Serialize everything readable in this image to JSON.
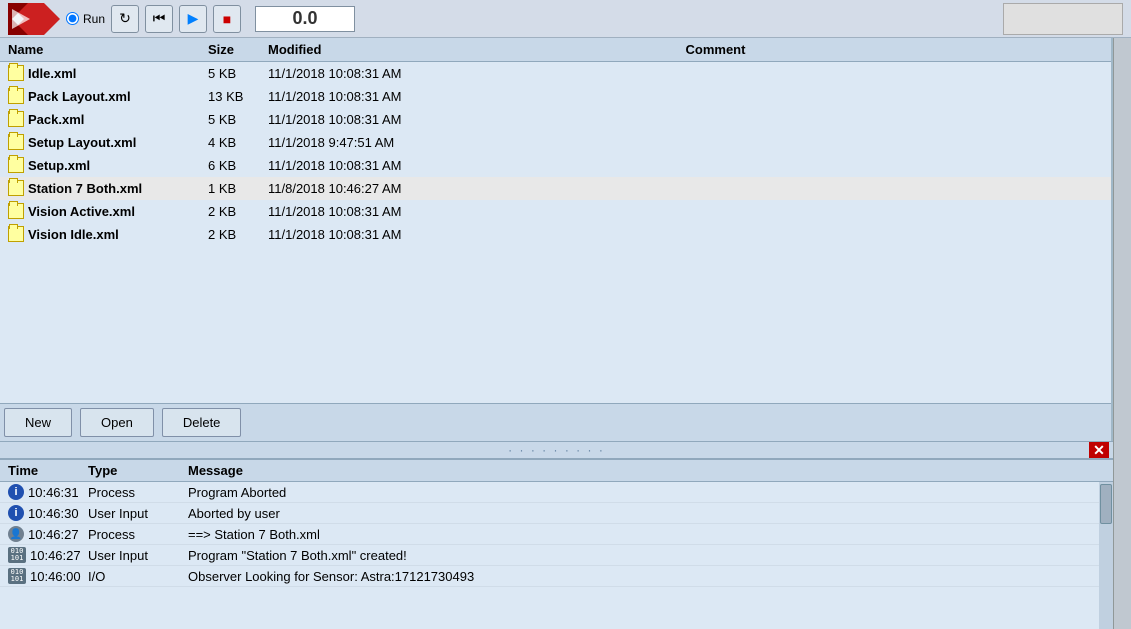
{
  "toolbar": {
    "radio_label": "Run",
    "version": "0.0",
    "btn_back": "⏮",
    "btn_play": "▶",
    "btn_stop": "■",
    "btn_refresh": "↻"
  },
  "file_list": {
    "headers": {
      "name": "Name",
      "size": "Size",
      "modified": "Modified",
      "comment": "Comment"
    },
    "rows": [
      {
        "name": "Idle.xml",
        "size": "5 KB",
        "modified": "11/1/2018 10:08:31 AM",
        "comment": ""
      },
      {
        "name": "Pack Layout.xml",
        "size": "13 KB",
        "modified": "11/1/2018 10:08:31 AM",
        "comment": ""
      },
      {
        "name": "Pack.xml",
        "size": "5 KB",
        "modified": "11/1/2018 10:08:31 AM",
        "comment": ""
      },
      {
        "name": "Setup Layout.xml",
        "size": "4 KB",
        "modified": "11/1/2018 9:47:51 AM",
        "comment": ""
      },
      {
        "name": "Setup.xml",
        "size": "6 KB",
        "modified": "11/1/2018 10:08:31 AM",
        "comment": ""
      },
      {
        "name": "Station 7 Both.xml",
        "size": "1 KB",
        "modified": "11/8/2018 10:46:27 AM",
        "comment": ""
      },
      {
        "name": "Vision Active.xml",
        "size": "2 KB",
        "modified": "11/1/2018 10:08:31 AM",
        "comment": ""
      },
      {
        "name": "Vision Idle.xml",
        "size": "2 KB",
        "modified": "11/1/2018 10:08:31 AM",
        "comment": ""
      }
    ],
    "buttons": {
      "new": "New",
      "open": "Open",
      "delete": "Delete"
    }
  },
  "splitter": {
    "dots": "...",
    "close_icon": "✕"
  },
  "log": {
    "headers": {
      "time": "Time",
      "type": "Type",
      "message": "Message"
    },
    "rows": [
      {
        "icon_type": "info",
        "icon_label": "i",
        "time": "10:46:31",
        "type": "Process",
        "message": "Program Aborted"
      },
      {
        "icon_type": "info",
        "icon_label": "i",
        "time": "10:46:30",
        "type": "User Input",
        "message": "Aborted by user"
      },
      {
        "icon_type": "user",
        "icon_label": "👤",
        "time": "10:46:27",
        "type": "Process",
        "message": "==> Station 7 Both.xml"
      },
      {
        "icon_type": "binary",
        "icon_label": "010",
        "time": "10:46:27",
        "type": "User Input",
        "message": "Program \"Station 7 Both.xml\" created!"
      },
      {
        "icon_type": "binary",
        "icon_label": "010",
        "time": "10:46:00",
        "type": "I/O",
        "message": "Observer Looking for Sensor: Astra:17121730493"
      }
    ]
  }
}
